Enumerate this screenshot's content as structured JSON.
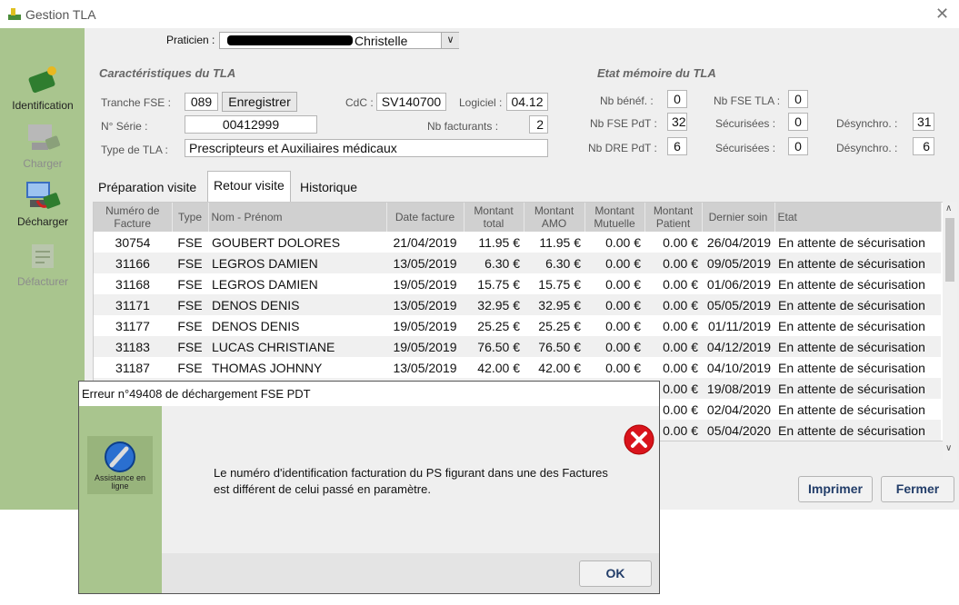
{
  "window": {
    "title": "Gestion TLA",
    "close_glyph": "✕"
  },
  "sidebar": {
    "items": [
      {
        "label": "Identification",
        "icon": "id-card-icon",
        "enabled": true
      },
      {
        "label": "Charger",
        "icon": "load-icon",
        "enabled": false
      },
      {
        "label": "Décharger",
        "icon": "unload-icon",
        "enabled": true
      },
      {
        "label": "Défacturer",
        "icon": "unbill-icon",
        "enabled": false
      }
    ]
  },
  "header": {
    "praticien_label": "Praticien :",
    "praticien_value": "Christelle"
  },
  "caracteristiques": {
    "title": "Caractéristiques du TLA",
    "tranche_label": "Tranche FSE :",
    "tranche_value": "089",
    "enregistrer_label": "Enregistrer",
    "cdc_label": "CdC :",
    "cdc_value": "SV140700",
    "logiciel_label": "Logiciel :",
    "logiciel_value": "04.12",
    "serie_label": "N° Série :",
    "serie_value": "00412999",
    "nb_facturants_label": "Nb facturants :",
    "nb_facturants_value": "2",
    "type_label": "Type de TLA :",
    "type_value": "Prescripteurs et Auxiliaires médicaux"
  },
  "etat_memoire": {
    "title": "Etat mémoire du TLA",
    "nb_benef_label": "Nb bénéf. :",
    "nb_benef_value": "0",
    "nb_fse_tla_label": "Nb FSE TLA :",
    "nb_fse_tla_value": "0",
    "nb_fse_pdt_label": "Nb FSE PdT :",
    "nb_fse_pdt_value": "32",
    "securisees_label_1": "Sécurisées :",
    "securisees_value_1": "0",
    "desynchro_label_1": "Désynchro. :",
    "desynchro_value_1": "31",
    "nb_dre_pdt_label": "Nb DRE PdT :",
    "nb_dre_pdt_value": "6",
    "securisees_label_2": "Sécurisées :",
    "securisees_value_2": "0",
    "desynchro_label_2": "Désynchro. :",
    "desynchro_value_2": "6"
  },
  "tabs": [
    "Préparation visite",
    "Retour visite",
    "Historique"
  ],
  "table": {
    "headers": [
      "Numéro de Facture",
      "Type",
      "Nom - Prénom",
      "Date facture",
      "Montant total",
      "Montant AMO",
      "Montant Mutuelle",
      "Montant Patient",
      "Dernier soin",
      "Etat"
    ],
    "rows": [
      [
        "30754",
        "FSE",
        "GOUBERT DOLORES",
        "21/04/2019",
        "11.95 €",
        "11.95 €",
        "0.00 €",
        "0.00 €",
        "26/04/2019",
        "En attente de sécurisation"
      ],
      [
        "31166",
        "FSE",
        "LEGROS DAMIEN",
        "13/05/2019",
        "6.30 €",
        "6.30 €",
        "0.00 €",
        "0.00 €",
        "09/05/2019",
        "En attente de sécurisation"
      ],
      [
        "31168",
        "FSE",
        "LEGROS DAMIEN",
        "19/05/2019",
        "15.75 €",
        "15.75 €",
        "0.00 €",
        "0.00 €",
        "01/06/2019",
        "En attente de sécurisation"
      ],
      [
        "31171",
        "FSE",
        "DENOS DENIS",
        "13/05/2019",
        "32.95 €",
        "32.95 €",
        "0.00 €",
        "0.00 €",
        "05/05/2019",
        "En attente de sécurisation"
      ],
      [
        "31177",
        "FSE",
        "DENOS DENIS",
        "19/05/2019",
        "25.25 €",
        "25.25 €",
        "0.00 €",
        "0.00 €",
        "01/11/2019",
        "En attente de sécurisation"
      ],
      [
        "31183",
        "FSE",
        "LUCAS CHRISTIANE",
        "19/05/2019",
        "76.50 €",
        "76.50 €",
        "0.00 €",
        "0.00 €",
        "04/12/2019",
        "En attente de sécurisation"
      ],
      [
        "31187",
        "FSE",
        "THOMAS JOHNNY",
        "13/05/2019",
        "42.00 €",
        "42.00 €",
        "0.00 €",
        "0.00 €",
        "04/10/2019",
        "En attente de sécurisation"
      ],
      [
        "",
        "",
        "",
        "",
        "",
        "",
        "",
        "0.00 €",
        "19/08/2019",
        "En attente de sécurisation"
      ],
      [
        "",
        "",
        "",
        "",
        "",
        "",
        "",
        "0.00 €",
        "02/04/2020",
        "En attente de sécurisation"
      ],
      [
        "",
        "",
        "",
        "",
        "",
        "",
        "",
        "0.00 €",
        "05/04/2020",
        "En attente de sécurisation"
      ]
    ]
  },
  "buttons": {
    "imprimer": "Imprimer",
    "fermer": "Fermer"
  },
  "dialog": {
    "title": "Erreur n°49408 de déchargement FSE PDT",
    "message": "Le numéro d'identification facturation du PS figurant dans une des Factures est différent de celui passé en paramètre.",
    "assist_label": "Assistance en ligne",
    "ok_label": "OK",
    "error_icon": "error-icon"
  }
}
